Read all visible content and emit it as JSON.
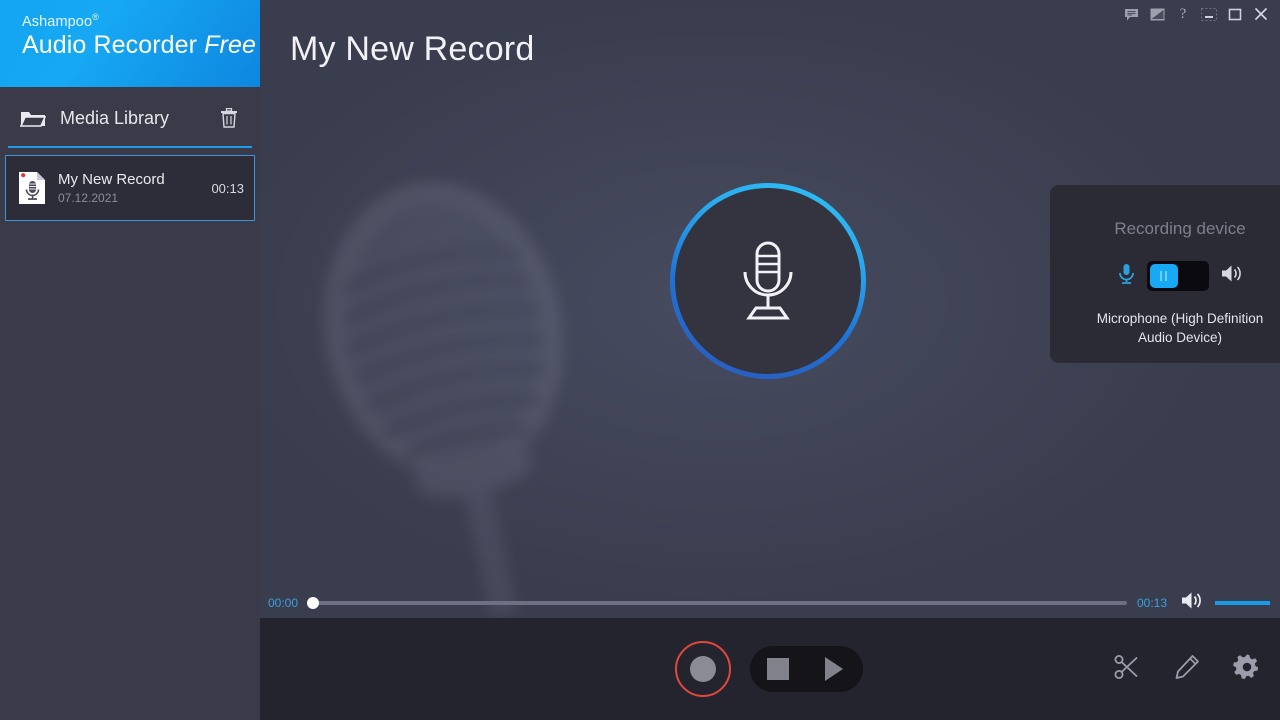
{
  "brand": {
    "company": "Ashampoo",
    "registered": "®",
    "product": "Audio Recorder ",
    "edition": "Free"
  },
  "sidebar": {
    "media_library": {
      "label": "Media Library",
      "folder_icon": "folder-icon",
      "delete_icon": "trash-icon"
    },
    "records": [
      {
        "title": "My New Record",
        "date": "07.12.2021",
        "duration": "00:13",
        "icon": "audio-document-icon",
        "selected": true
      }
    ]
  },
  "titlebar": {
    "buttons": [
      {
        "name": "feedback-icon",
        "label": "Feedback"
      },
      {
        "name": "news-icon",
        "label": "News"
      },
      {
        "name": "help-icon",
        "label": "?"
      },
      {
        "name": "minimize-icon",
        "label": "Minimize"
      },
      {
        "name": "maximize-icon",
        "label": "Maximize"
      },
      {
        "name": "close-icon",
        "label": "Close"
      }
    ]
  },
  "main": {
    "page_title": "My New Record",
    "mic_button": "microphone-circle-button"
  },
  "device_panel": {
    "title": "Recording device",
    "mic_icon": "microphone-icon",
    "speaker_icon": "speaker-icon",
    "toggle_state": "microphone",
    "device_name": "Microphone (High Definition Audio Device)"
  },
  "player": {
    "current_time": "00:00",
    "total_time": "00:13",
    "seek_position_percent": 0,
    "volume_icon": "volume-icon",
    "volume_percent": 100
  },
  "toolbar": {
    "record_label": "Record",
    "stop_label": "Stop",
    "play_label": "Play",
    "cut_icon": "scissors-icon",
    "edit_icon": "pencil-icon",
    "settings_icon": "gear-icon"
  },
  "colors": {
    "accent_blue": "#1b9ae8",
    "brand_blue": "#16a8f2",
    "record_red": "#e0483c",
    "sidebar_bg": "#3a3a48",
    "main_bg": "#3a3d4d",
    "toolbar_bg": "#24242e",
    "panel_bg": "#2b2b35"
  }
}
